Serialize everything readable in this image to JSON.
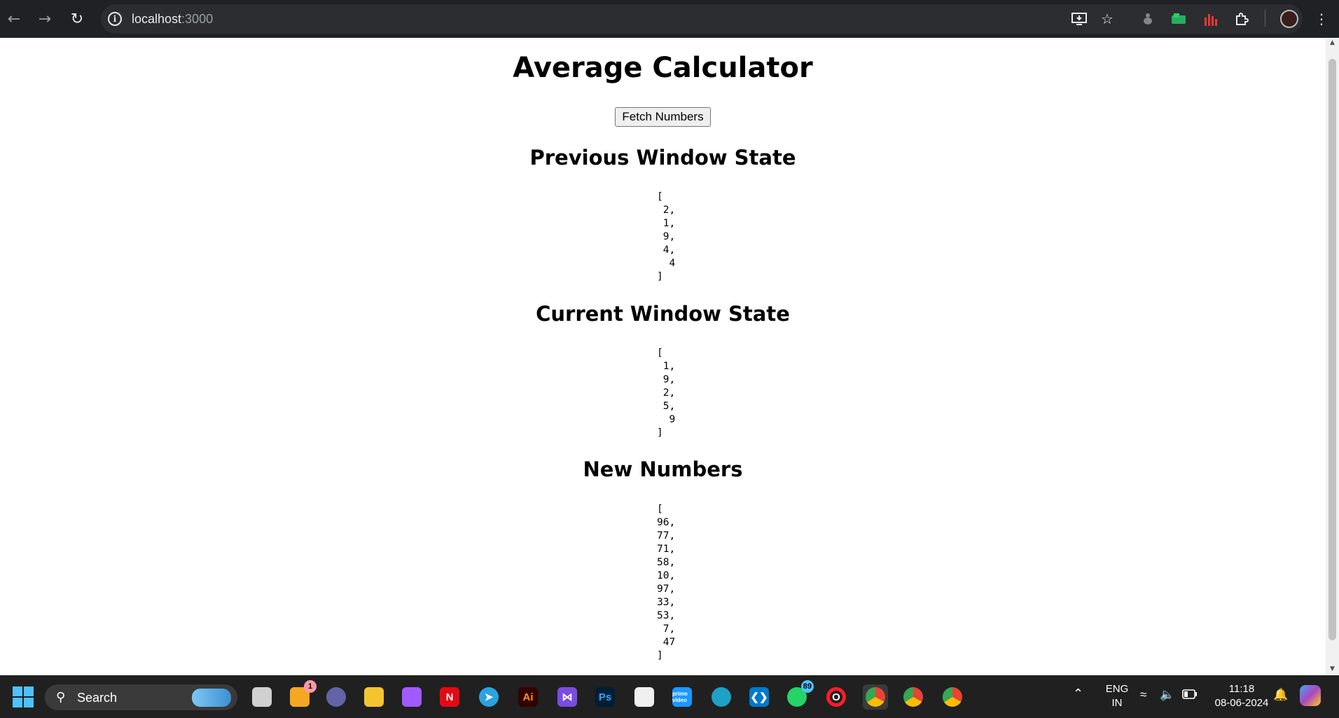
{
  "browser": {
    "url_host": "localhost",
    "url_port": ":3000"
  },
  "page": {
    "title": "Average Calculator",
    "fetch_button": "Fetch Numbers",
    "sections": [
      {
        "heading": "Previous Window State",
        "array_text": "[\n 2,\n 1,\n 9,\n 4,\n  4\n]"
      },
      {
        "heading": "Current Window State",
        "array_text": "[\n 1,\n 9,\n 2,\n 5,\n  9\n]"
      },
      {
        "heading": "New Numbers",
        "array_text": "[\n96,\n77,\n71,\n58,\n10,\n97,\n33,\n53,\n 7,\n 47\n]"
      }
    ]
  },
  "taskbar": {
    "search_label": "Search",
    "apps": [
      {
        "name": "task-view",
        "glyph": ""
      },
      {
        "name": "burger-app",
        "glyph": "",
        "badge": "1",
        "badge_color": "#ff99a4"
      },
      {
        "name": "teams",
        "glyph": ""
      },
      {
        "name": "file-explorer",
        "glyph": ""
      },
      {
        "name": "figma",
        "glyph": ""
      },
      {
        "name": "netflix",
        "glyph": "N"
      },
      {
        "name": "telegram",
        "glyph": "➤"
      },
      {
        "name": "illustrator",
        "glyph": "Ai"
      },
      {
        "name": "visual-studio",
        "glyph": "⋈"
      },
      {
        "name": "photoshop",
        "glyph": "Ps"
      },
      {
        "name": "microsoft-store",
        "glyph": ""
      },
      {
        "name": "prime-video",
        "glyph": "prime video"
      },
      {
        "name": "edge",
        "glyph": ""
      },
      {
        "name": "vscode",
        "glyph": "❮❯"
      },
      {
        "name": "whatsapp",
        "glyph": "",
        "badge": "89",
        "badge_color": "#4fc3f7"
      },
      {
        "name": "opera",
        "glyph": "O"
      },
      {
        "name": "chrome-1",
        "glyph": ""
      },
      {
        "name": "chrome-2",
        "glyph": ""
      },
      {
        "name": "chrome-3",
        "glyph": ""
      }
    ],
    "lang_line1": "ENG",
    "lang_line2": "IN",
    "time": "11:18",
    "date": "08-06-2024"
  }
}
